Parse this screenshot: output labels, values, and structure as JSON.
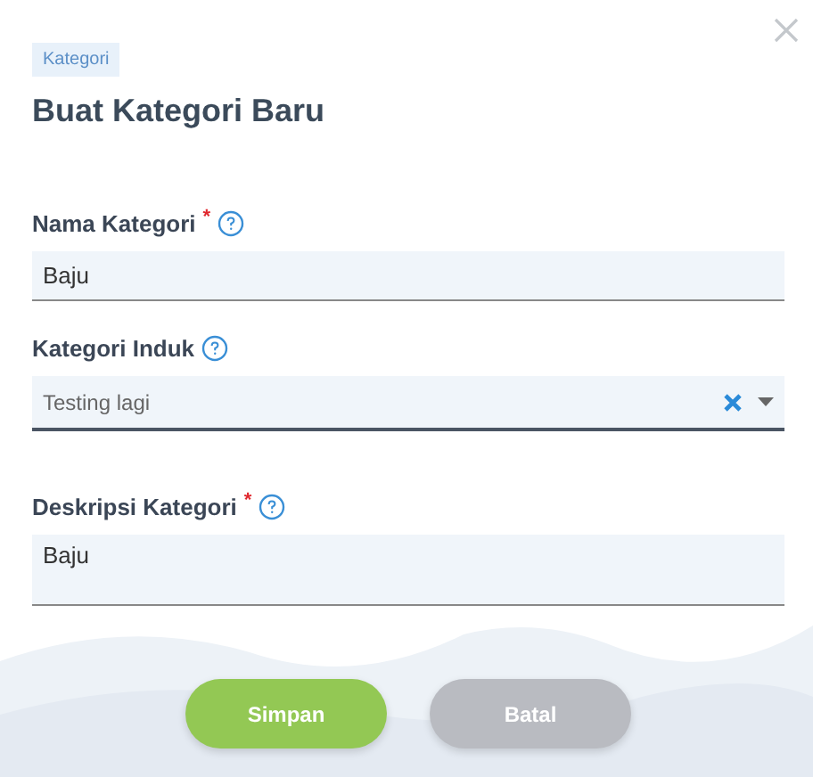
{
  "badge": "Kategori",
  "title": "Buat Kategori Baru",
  "fields": [
    {
      "kind": "text",
      "label": "Nama Kategori",
      "required_mark": "*",
      "value": "Baju"
    },
    {
      "kind": "select",
      "label": "Kategori Induk",
      "value": "Testing lagi"
    },
    {
      "kind": "textarea",
      "label": "Deskripsi Kategori",
      "required_mark": "*",
      "value": "Baju"
    }
  ],
  "buttons": [
    {
      "label": "Simpan",
      "kind": "primary"
    },
    {
      "label": "Batal",
      "kind": "secondary"
    }
  ]
}
